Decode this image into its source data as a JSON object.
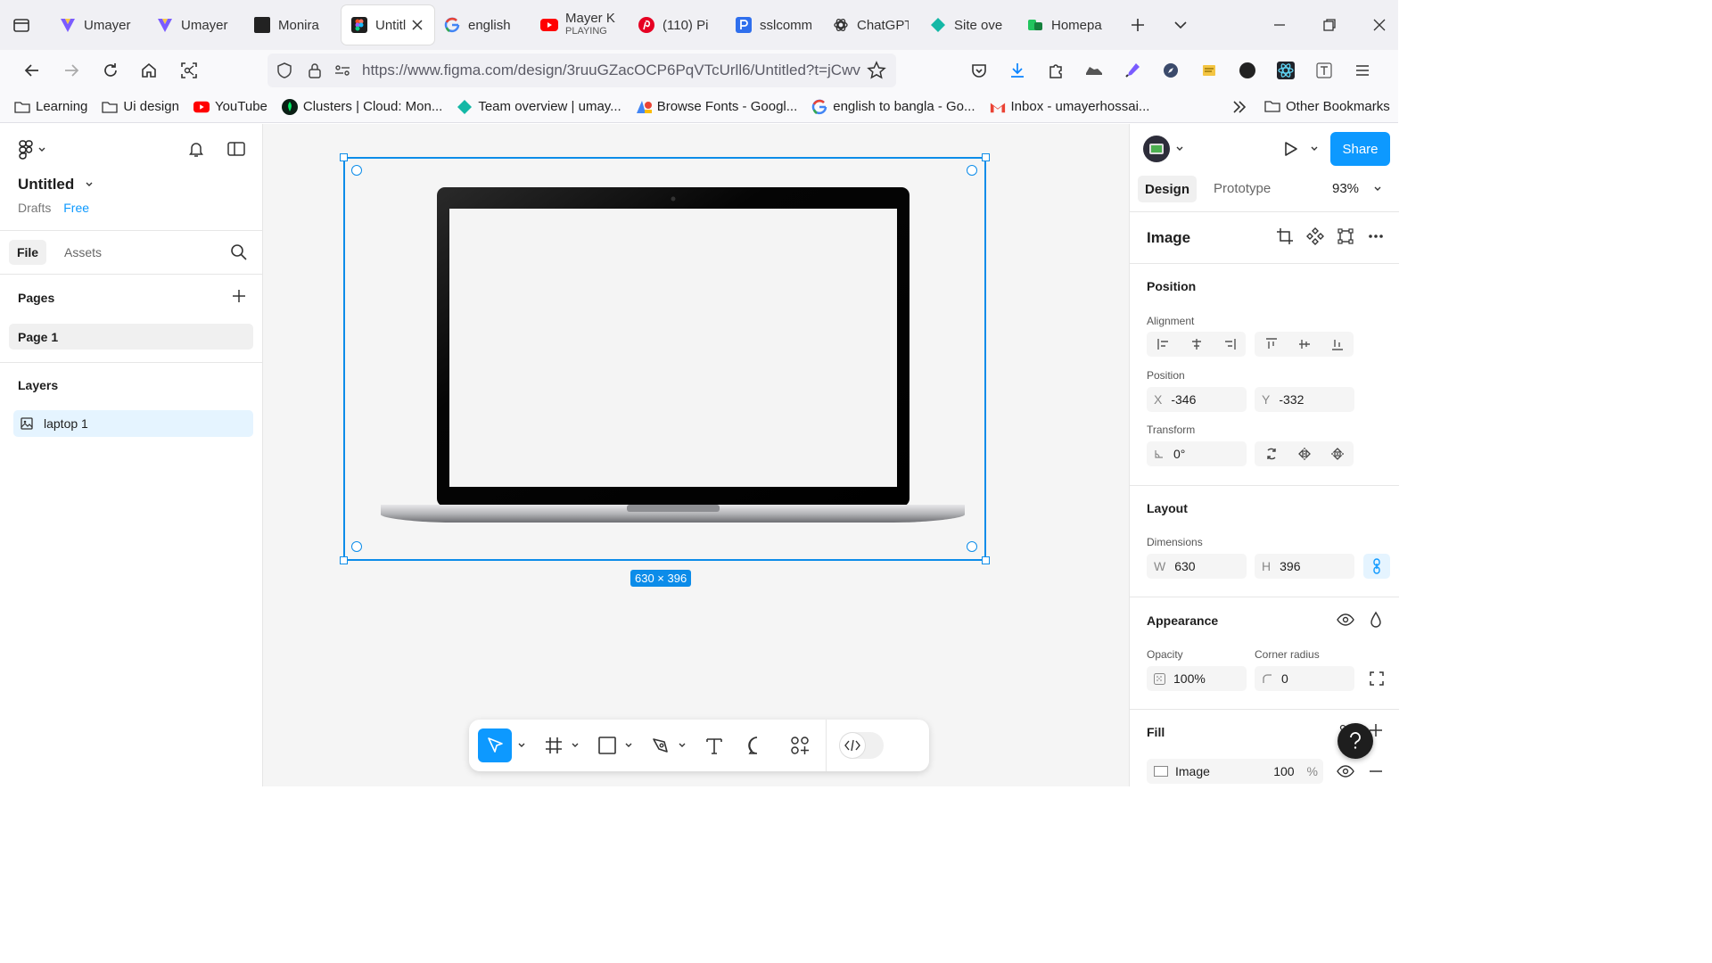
{
  "browser": {
    "tabs": [
      {
        "label": "Umayer",
        "icon": "v-logo-icon"
      },
      {
        "label": "Umayer",
        "icon": "v-logo-icon"
      },
      {
        "label": "Monira",
        "icon": "dark-square-icon"
      },
      {
        "label": "Untitl",
        "icon": "figma-icon",
        "active": true
      },
      {
        "label": "english",
        "icon": "google-icon"
      },
      {
        "label": "Mayer K",
        "sub": "PLAYING",
        "icon": "youtube-icon"
      },
      {
        "label": "(110) Pi",
        "icon": "pinterest-icon"
      },
      {
        "label": "sslcomm",
        "icon": "p-blue-icon"
      },
      {
        "label": "ChatGPT",
        "icon": "chatgpt-icon"
      },
      {
        "label": "Site ove",
        "icon": "teal-diamond-icon"
      },
      {
        "label": "Homepa",
        "icon": "green-logo-icon"
      }
    ],
    "url": "https://www.figma.com/design/3ruuGZacOCP6PqVTcUrll6/Untitled?t=jCwv",
    "bookmarks": [
      {
        "label": "Learning",
        "icon": "folder-icon"
      },
      {
        "label": "Ui design",
        "icon": "folder-icon"
      },
      {
        "label": "YouTube",
        "icon": "youtube-icon"
      },
      {
        "label": "Clusters | Cloud: Mon...",
        "icon": "mongodb-icon"
      },
      {
        "label": "Team overview | umay...",
        "icon": "teal-diamond-icon"
      },
      {
        "label": "Browse Fonts - Googl...",
        "icon": "google-fonts-icon"
      },
      {
        "label": "english to bangla - Go...",
        "icon": "google-icon"
      },
      {
        "label": "Inbox - umayerhossai...",
        "icon": "gmail-icon"
      }
    ],
    "other_bookmarks": "Other Bookmarks"
  },
  "left": {
    "file_name": "Untitled",
    "drafts": "Drafts",
    "plan": "Free",
    "tabs": {
      "file": "File",
      "assets": "Assets"
    },
    "pages_title": "Pages",
    "pages": [
      "Page 1"
    ],
    "layers_title": "Layers",
    "layers": [
      "laptop 1"
    ]
  },
  "canvas": {
    "size_label": "630 × 396"
  },
  "right": {
    "share": "Share",
    "tabs": {
      "design": "Design",
      "prototype": "Prototype"
    },
    "zoom": "93%",
    "selection_type": "Image",
    "position_title": "Position",
    "alignment_label": "Alignment",
    "position_label": "Position",
    "x_label": "X",
    "x": "-346",
    "y_label": "Y",
    "y": "-332",
    "transform_label": "Transform",
    "rotation": "0°",
    "layout_title": "Layout",
    "dimensions_label": "Dimensions",
    "w_label": "W",
    "w": "630",
    "h_label": "H",
    "h": "396",
    "appearance_title": "Appearance",
    "opacity_label": "Opacity",
    "opacity": "100%",
    "corner_label": "Corner radius",
    "corner": "0",
    "fill_title": "Fill",
    "fill_type": "Image",
    "fill_opacity": "100",
    "fill_unit": "%"
  },
  "colors": {
    "accent": "#0d99ff",
    "selection": "#0c8ce9"
  }
}
